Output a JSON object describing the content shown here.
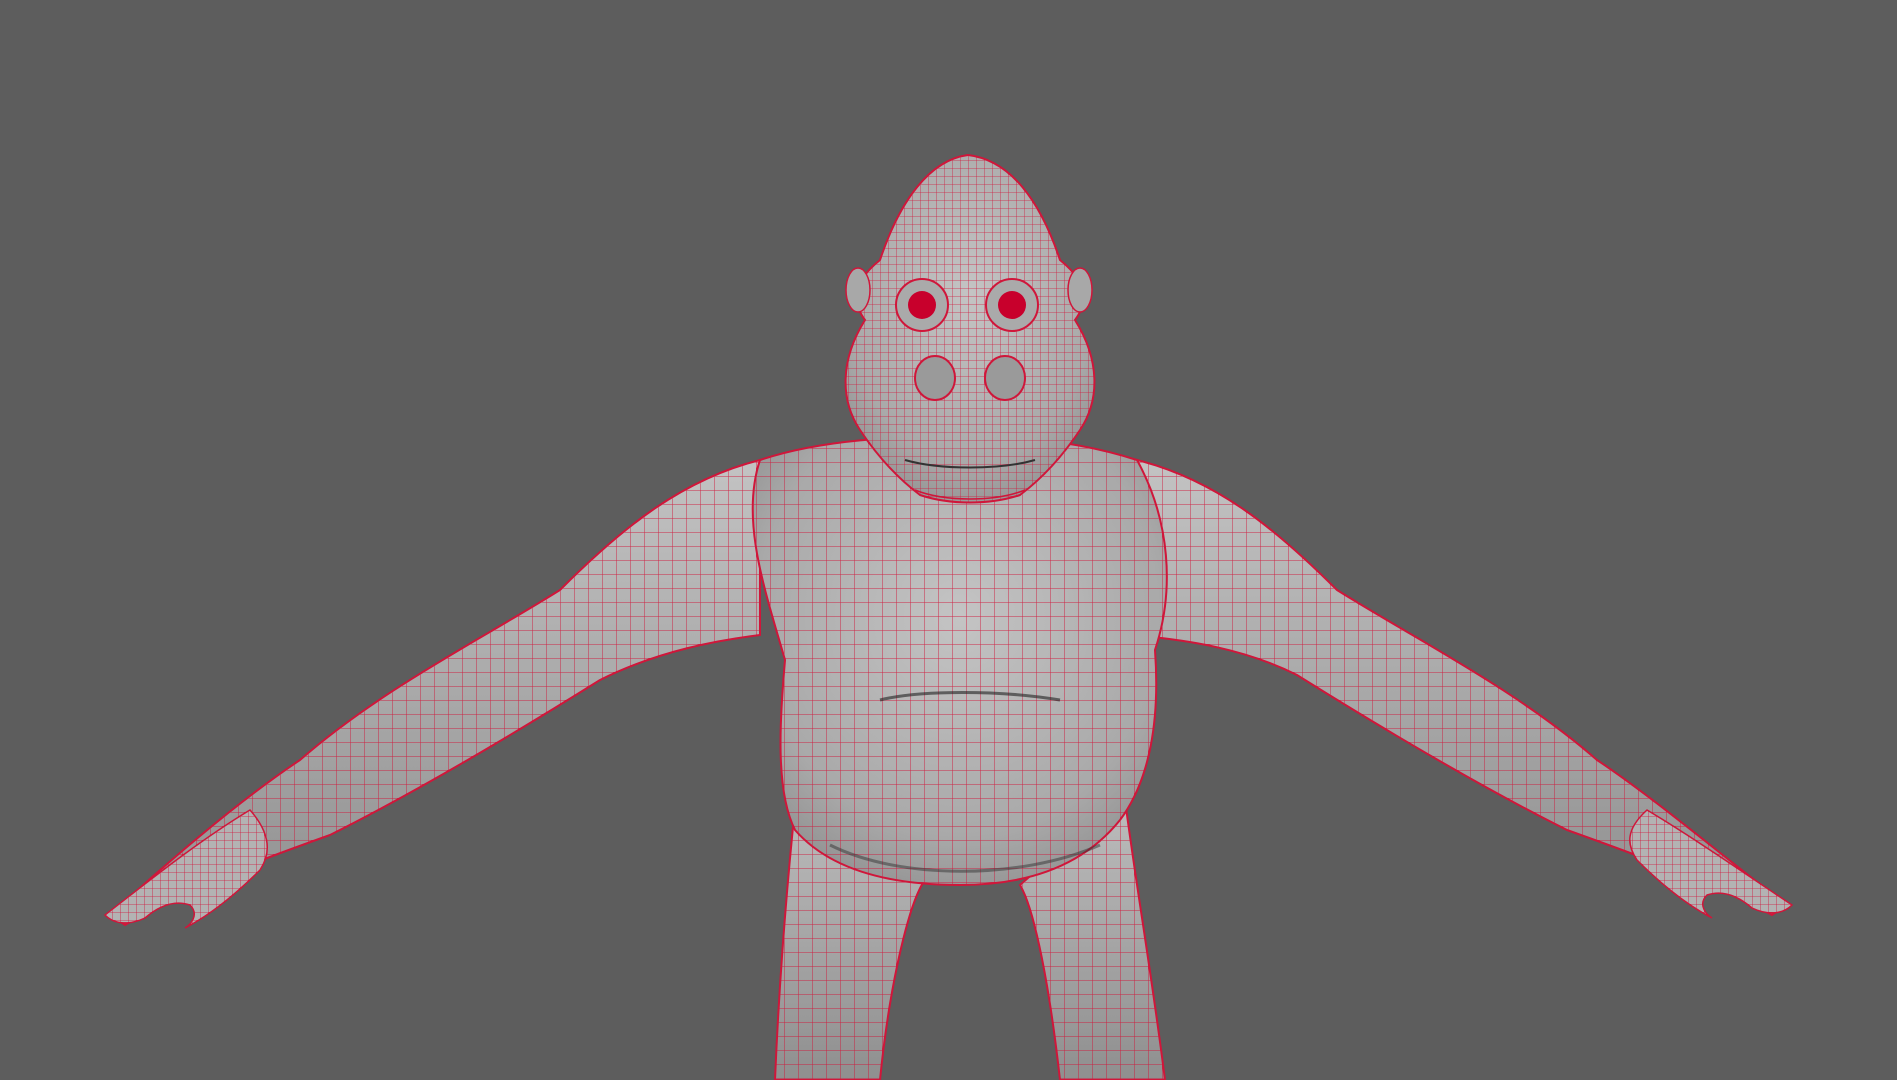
{
  "viewport": {
    "background_color": "#5d5d5d",
    "view": "front",
    "display_mode": "wireframe-on-shaded"
  },
  "model": {
    "subject": "gorilla",
    "pose": "A-pose",
    "surface_color": "#b9b9b9",
    "wireframe_color": "#d0163a",
    "eye_color": "#c8002c"
  }
}
